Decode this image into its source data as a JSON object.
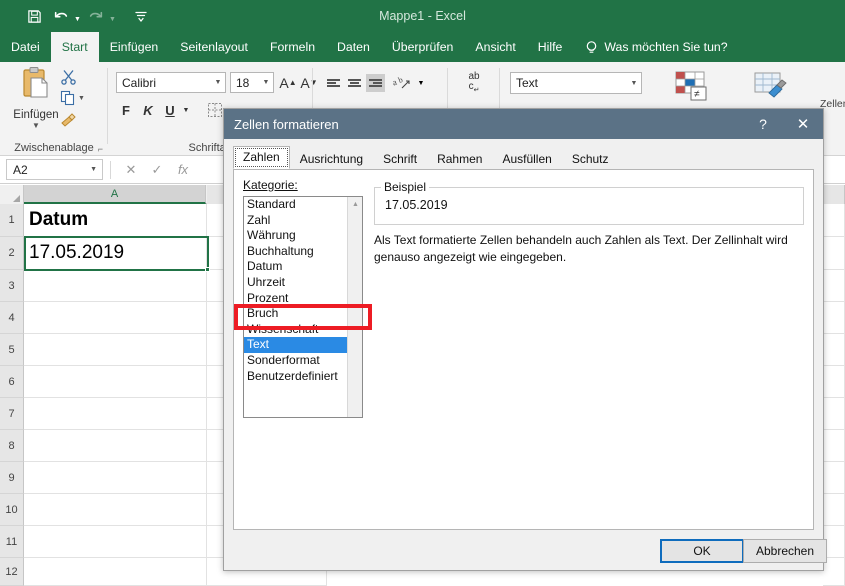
{
  "window": {
    "title": "Mappe1  -  Excel",
    "accent": "#217346"
  },
  "quick_access": {
    "save": "save-icon",
    "undo": "undo-icon",
    "redo": "redo-icon",
    "customize": "customize-qat-icon"
  },
  "ribbon": {
    "tabs": [
      {
        "label": "Datei",
        "active": false
      },
      {
        "label": "Start",
        "active": true
      },
      {
        "label": "Einfügen",
        "active": false
      },
      {
        "label": "Seitenlayout",
        "active": false
      },
      {
        "label": "Formeln",
        "active": false
      },
      {
        "label": "Daten",
        "active": false
      },
      {
        "label": "Überprüfen",
        "active": false
      },
      {
        "label": "Ansicht",
        "active": false
      },
      {
        "label": "Hilfe",
        "active": false
      }
    ],
    "tell_me": "Was möchten Sie tun?",
    "groups": {
      "clipboard": {
        "label": "Zwischenablage",
        "paste": "Einfügen",
        "cut_icon": "scissors-icon",
        "copy_icon": "copy-icon",
        "format_painter_icon": "format-painter-icon"
      },
      "font": {
        "label": "Schriftart",
        "font_name": "Calibri",
        "font_size": "18",
        "bold": "F",
        "italic": "K",
        "underline": "U",
        "grow_font": "A",
        "shrink_font": "A"
      },
      "alignment": {
        "wrap_text": "ab",
        "orientation_icon": "orientation-icon"
      },
      "number": {
        "format": "Text"
      },
      "styles": {
        "conditional": "Bedingte",
        "as_table": "Als Tabelle",
        "cell_styles": "Zellenf"
      }
    }
  },
  "formula_bar": {
    "name_box": "A2",
    "cancel_icon": "cancel-icon",
    "accept_icon": "accept-icon",
    "function_icon": "insert-function-icon",
    "content": ""
  },
  "sheet": {
    "columns": [
      "A"
    ],
    "rows": [
      "1",
      "2",
      "3",
      "4",
      "5",
      "6",
      "7",
      "8",
      "9",
      "10",
      "11",
      "12"
    ],
    "cells": {
      "A1": "Datum",
      "A2": "17.05.2019"
    },
    "selected_cell": "A2"
  },
  "dialog": {
    "title": "Zellen formatieren",
    "help_icon": "?",
    "close_icon": "✕",
    "tabs": [
      {
        "label": "Zahlen",
        "active": true
      },
      {
        "label": "Ausrichtung",
        "active": false
      },
      {
        "label": "Schrift",
        "active": false
      },
      {
        "label": "Rahmen",
        "active": false
      },
      {
        "label": "Ausfüllen",
        "active": false
      },
      {
        "label": "Schutz",
        "active": false
      }
    ],
    "category_label": "Kategorie:",
    "categories": [
      {
        "label": "Standard",
        "selected": false
      },
      {
        "label": "Zahl",
        "selected": false
      },
      {
        "label": "Währung",
        "selected": false
      },
      {
        "label": "Buchhaltung",
        "selected": false
      },
      {
        "label": "Datum",
        "selected": false
      },
      {
        "label": "Uhrzeit",
        "selected": false
      },
      {
        "label": "Prozent",
        "selected": false
      },
      {
        "label": "Bruch",
        "selected": false
      },
      {
        "label": "Wissenschaft",
        "selected": false
      },
      {
        "label": "Text",
        "selected": true
      },
      {
        "label": "Sonderformat",
        "selected": false
      },
      {
        "label": "Benutzerdefiniert",
        "selected": false
      }
    ],
    "example_legend": "Beispiel",
    "example_value": "17.05.2019",
    "description": "Als Text formatierte Zellen behandeln auch Zahlen als Text. Der Zellinhalt wird genauso angezeigt wie eingegeben.",
    "ok": "OK",
    "cancel": "Abbrechen"
  },
  "annotation": {
    "color": "#ed1c24",
    "target": "Text"
  }
}
